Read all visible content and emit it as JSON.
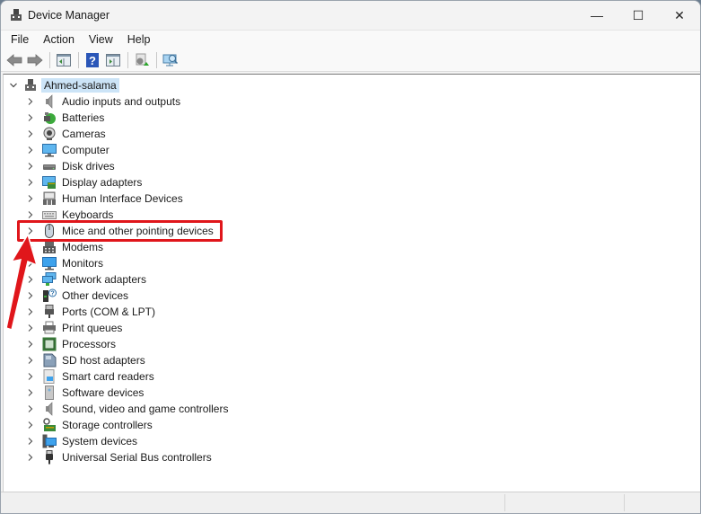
{
  "window": {
    "title": "Device Manager",
    "controls": {
      "minimize": "—",
      "maximize": "☐",
      "close": "✕"
    }
  },
  "menu": [
    "File",
    "Action",
    "View",
    "Help"
  ],
  "toolbar": {
    "buttons": [
      "back-icon",
      "forward-icon",
      "show-hide-console-tree-icon",
      "help-icon",
      "action-pane-icon",
      "update-driver-icon",
      "scan-hardware-icon"
    ]
  },
  "tree": {
    "root": {
      "label": "Ahmed-salama",
      "expanded": true
    },
    "items": [
      {
        "label": "Audio inputs and outputs",
        "icon": "speaker-icon"
      },
      {
        "label": "Batteries",
        "icon": "battery-icon"
      },
      {
        "label": "Cameras",
        "icon": "camera-icon"
      },
      {
        "label": "Computer",
        "icon": "computer-icon"
      },
      {
        "label": "Disk drives",
        "icon": "disk-drive-icon"
      },
      {
        "label": "Display adapters",
        "icon": "display-adapter-icon"
      },
      {
        "label": "Human Interface Devices",
        "icon": "hid-icon"
      },
      {
        "label": "Keyboards",
        "icon": "keyboard-icon"
      },
      {
        "label": "Mice and other pointing devices",
        "icon": "mouse-icon",
        "highlighted": true
      },
      {
        "label": "Modems",
        "icon": "modem-icon"
      },
      {
        "label": "Monitors",
        "icon": "monitor-icon"
      },
      {
        "label": "Network adapters",
        "icon": "network-adapter-icon"
      },
      {
        "label": "Other devices",
        "icon": "unknown-device-icon"
      },
      {
        "label": "Ports (COM & LPT)",
        "icon": "port-icon"
      },
      {
        "label": "Print queues",
        "icon": "printer-icon"
      },
      {
        "label": "Processors",
        "icon": "processor-icon"
      },
      {
        "label": "SD host adapters",
        "icon": "sd-card-icon"
      },
      {
        "label": "Smart card readers",
        "icon": "smart-card-icon"
      },
      {
        "label": "Software devices",
        "icon": "software-device-icon"
      },
      {
        "label": "Sound, video and game controllers",
        "icon": "speaker-icon"
      },
      {
        "label": "Storage controllers",
        "icon": "storage-controller-icon"
      },
      {
        "label": "System devices",
        "icon": "system-device-icon"
      },
      {
        "label": "Universal Serial Bus controllers",
        "icon": "usb-icon"
      }
    ]
  },
  "annotation": {
    "color": "#e0161b",
    "target": "Mice and other pointing devices"
  }
}
